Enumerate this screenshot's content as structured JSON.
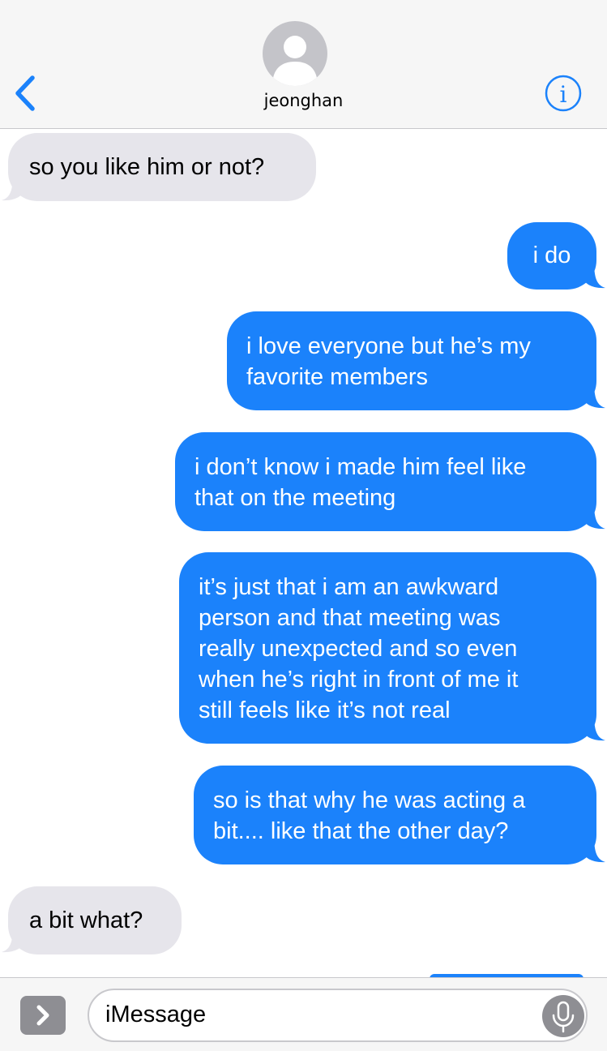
{
  "header": {
    "contact_name": "jeonghan",
    "back_icon": "chevron-left-icon",
    "info_icon": "info-icon",
    "accent_color": "#1b82fb"
  },
  "messages": [
    {
      "direction": "incoming",
      "text": "so you like him or not?"
    },
    {
      "direction": "outgoing",
      "text": "i do"
    },
    {
      "direction": "outgoing",
      "lines": [
        "i love everyone but he’s my",
        "favorite members"
      ]
    },
    {
      "direction": "outgoing",
      "lines": [
        "i don’t know i made him feel like",
        "that on the meeting"
      ]
    },
    {
      "direction": "outgoing",
      "lines": [
        "it’s just that i am an awkward",
        "person and that meeting was",
        "really unexpected and so even",
        "when he’s right in front of me it",
        "still feels like it’s not real"
      ]
    },
    {
      "direction": "outgoing",
      "lines": [
        "so is that why he was acting a",
        "bit.... like that the other day?"
      ]
    },
    {
      "direction": "incoming",
      "text": "a bit what?"
    }
  ],
  "composer": {
    "placeholder": "iMessage",
    "expand_icon": "chevron-right-icon",
    "mic_icon": "microphone-icon"
  },
  "colors": {
    "incoming_bubble": "#e6e5eb",
    "outgoing_bubble": "#1b82fb"
  }
}
